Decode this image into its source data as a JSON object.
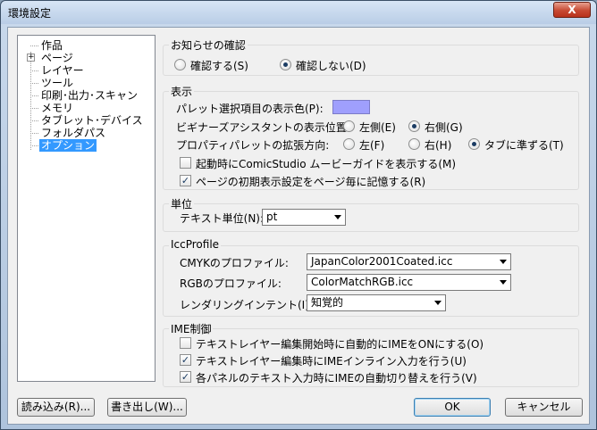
{
  "window": {
    "title": "環境設定",
    "close_glyph": "X"
  },
  "tree": {
    "items": [
      {
        "label": "作品"
      },
      {
        "label": "ページ",
        "expander": "+"
      },
      {
        "label": "レイヤー"
      },
      {
        "label": "ツール"
      },
      {
        "label": "印刷･出力･スキャン"
      },
      {
        "label": "メモリ"
      },
      {
        "label": "タブレット･デバイス"
      },
      {
        "label": "フォルダパス"
      },
      {
        "label": "オプション",
        "selected": true
      }
    ]
  },
  "notice": {
    "title": "お知らせの確認",
    "confirm_label": "確認する(S)",
    "noconfirm_label": "確認しない(D)",
    "selected": "noconfirm"
  },
  "display": {
    "title": "表示",
    "palette_color_label": "パレット選択項目の表示色(P):",
    "palette_color": "#9f9ffd",
    "beginner_label": "ビギナーズアシスタントの表示位置:",
    "beginner_left": "左側(E)",
    "beginner_right": "右側(G)",
    "beginner_selected": "right",
    "property_label": "プロパティパレットの拡張方向:",
    "property_left": "左(F)",
    "property_right": "右(H)",
    "property_tab": "タブに準ずる(T)",
    "property_selected": "tab",
    "startup_guide_label": "起動時にComicStudio ムービーガイドを表示する(M)",
    "startup_guide_checked": false,
    "page_memory_label": "ページの初期表示設定をページ毎に記憶する(R)",
    "page_memory_checked": true,
    "check_glyph": "✓"
  },
  "unit": {
    "title": "単位",
    "text_unit_label": "テキスト単位(N):",
    "text_unit_value": "pt"
  },
  "icc": {
    "title": "IccProfile",
    "cmyk_label": "CMYKのプロファイル:",
    "cmyk_value": "JapanColor2001Coated.icc",
    "rgb_label": "RGBのプロファイル:",
    "rgb_value": "ColorMatchRGB.icc",
    "intent_label": "レンダリングインテント(I):",
    "intent_value": "知覚的"
  },
  "ime": {
    "title": "IME制御",
    "opt1_label": "テキストレイヤー編集開始時に自動的にIMEをONにする(O)",
    "opt1_checked": false,
    "opt2_label": "テキストレイヤー編集時にIMEインライン入力を行う(U)",
    "opt2_checked": true,
    "opt3_label": "各パネルのテキスト入力時にIMEの自動切り替えを行う(V)",
    "opt3_checked": true
  },
  "buttons": {
    "import": "読み込み(R)...",
    "export": "書き出し(W)...",
    "ok": "OK",
    "cancel": "キャンセル"
  }
}
